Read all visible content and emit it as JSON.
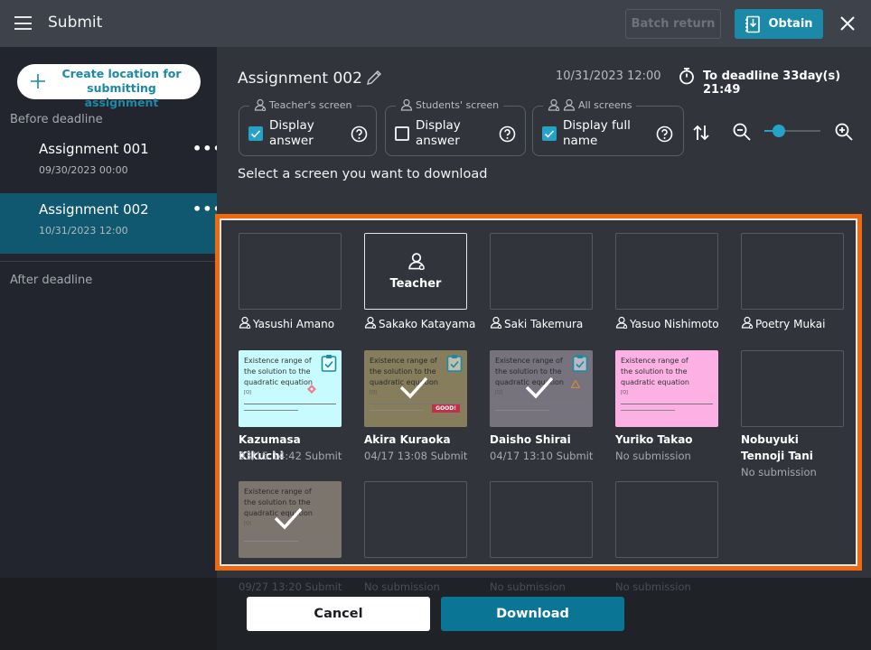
{
  "header": {
    "title": "Submit",
    "batch_return_label": "Batch return",
    "obtain_label": "Obtain",
    "menu_icon": "hamburger-icon",
    "close_icon": "close-icon"
  },
  "sidebar": {
    "create_button_label": "Create location for submitting assignment",
    "before_deadline_label": "Before deadline",
    "after_deadline_label": "After deadline",
    "assignments": [
      {
        "name": "Assignment 001",
        "date": "09/30/2023 00:00",
        "active": false
      },
      {
        "name": "Assignment 002",
        "date": "10/31/2023 12:00",
        "active": true
      }
    ],
    "more_label": "•••"
  },
  "main": {
    "title": "Assignment 002",
    "deadline_date": "10/31/2023 12:00",
    "deadline_remaining": "To deadline 33day(s) 21:49",
    "options": [
      {
        "legend": "Teacher's screen",
        "label": "Display answer",
        "checked": true
      },
      {
        "legend": "Students' screen",
        "label": "Display answer",
        "checked": false
      },
      {
        "legend": "All screens",
        "label": "Display full name",
        "checked": true
      }
    ],
    "zoom_level": 0.25,
    "select_hint": "Select a screen you want to download",
    "teacher_tile_label": "Teacher",
    "cells": [
      {
        "name": "Yasushi Amano",
        "type": "empty",
        "teacher_icon": true
      },
      {
        "name": "Sakako Katayama",
        "type": "teacher",
        "teacher_icon": true
      },
      {
        "name": "Saki Takemura",
        "type": "empty",
        "teacher_icon": true
      },
      {
        "name": "Yasuo Nishimoto",
        "type": "empty",
        "teacher_icon": true
      },
      {
        "name": "Poetry Mukai",
        "type": "empty",
        "teacher_icon": true
      },
      {
        "name": "Kazumasa Kikuchi",
        "status": "03/15 14:42 Submit",
        "type": "paper",
        "color": "#c8fbfd",
        "checked": false
      },
      {
        "name": "Akira Kuraoka",
        "status": "04/17 13:08 Submit",
        "type": "paper",
        "color": "#857d5b",
        "checked": true,
        "badge": "GOOD!"
      },
      {
        "name": "Daisho Shirai",
        "status": "04/17 13:10 Submit",
        "type": "paper",
        "color": "#76727e",
        "checked": true
      },
      {
        "name": "Yuriko Takao",
        "status": "No submission",
        "type": "paper",
        "color": "#fcb0e3",
        "checked": false
      },
      {
        "name": "Nobuyuki Tennoji Tani",
        "status": "No submission",
        "type": "empty"
      },
      {
        "name": "",
        "status": "09/27 13:20 Submit",
        "type": "paper",
        "color": "#7c756d",
        "checked": true
      },
      {
        "name": "",
        "status": "No submission",
        "type": "empty"
      },
      {
        "name": "",
        "status": "No submission",
        "type": "empty"
      },
      {
        "name": "",
        "status": "No submission",
        "type": "empty"
      }
    ],
    "paper_title": "Existence range of the solution to the quadratic equation",
    "paper_small": "[Q]"
  },
  "footer": {
    "cancel_label": "Cancel",
    "download_label": "Download"
  },
  "colors": {
    "accent": "#1a8aa8",
    "highlight_frame": "#ee6a10",
    "active_item": "#105870"
  }
}
